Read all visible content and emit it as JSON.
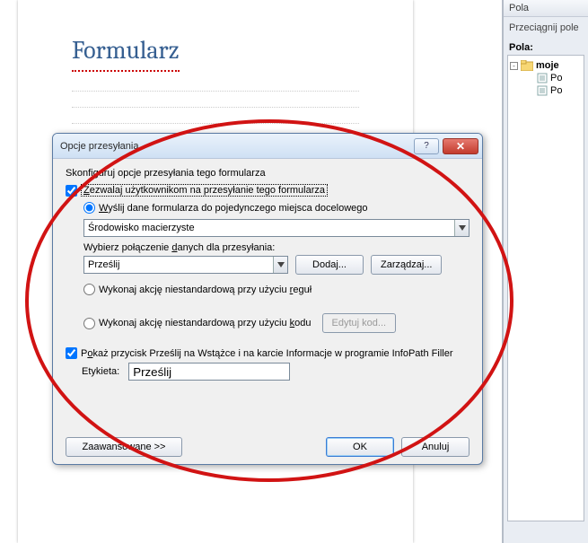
{
  "document": {
    "title": "Formularz"
  },
  "fieldsPane": {
    "title": "Pola",
    "instruction": "Przeciągnij pole",
    "label": "Pola:",
    "root": {
      "name": "moje",
      "toggle": "-"
    },
    "children": [
      {
        "name": "Po"
      },
      {
        "name": "Po"
      }
    ]
  },
  "dialog": {
    "title": "Opcje przesyłania",
    "description": "Skonfiguruj opcje przesyłania tego formularza",
    "allowSend_parts": [
      "Z",
      "ezwalaj użytkownikom na przesyłanie tego formularza"
    ],
    "radio1_parts": [
      "W",
      "yślij dane formularza do pojedynczego miejsca docelowego"
    ],
    "dest_combo": "Środowisko macierzyste",
    "conn_label_parts": [
      "Wybierz połączenie ",
      "d",
      "anych dla przesyłania:"
    ],
    "conn_combo": "Prześlij",
    "add_btn": "Dodaj...",
    "manage_btn": "Zarządzaj...",
    "radio2_parts": [
      "Wykonaj akcję niestandardową przy użyciu ",
      "r",
      "eguł"
    ],
    "radio3_parts": [
      "Wykonaj akcję niestandardową przy użyciu ",
      "k",
      "odu"
    ],
    "edit_code_btn": "Edytuj kod...",
    "show_button_parts": [
      "P",
      "o",
      "każ przycisk Prześlij na Wstążce i na karcie Informacje w programie InfoPath Filler"
    ],
    "etykieta_label": "Etykieta:",
    "etykieta_value": "Prześlij",
    "advanced_btn": "Zaawansowane >>",
    "ok_btn": "OK",
    "cancel_btn": "Anuluj",
    "help_glyph": "?",
    "close_glyph": "✕"
  }
}
